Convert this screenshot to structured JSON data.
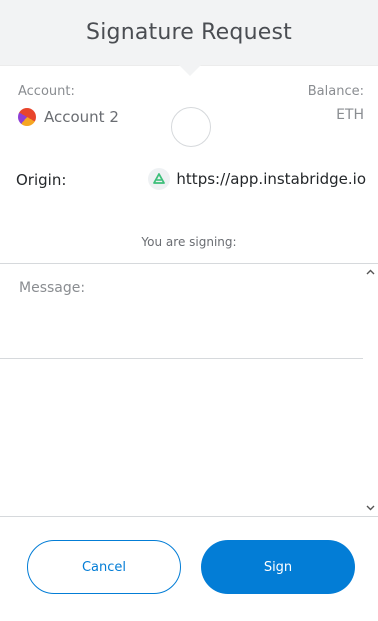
{
  "header": {
    "title": "Signature Request"
  },
  "account": {
    "label": "Account:",
    "name": "Account 2",
    "avatar_icon": "account-avatar-icon"
  },
  "balance": {
    "label": "Balance:",
    "value": "ETH"
  },
  "origin": {
    "label": "Origin:",
    "url": "https://app.instabridge.io",
    "icon": "instabridge-site-icon"
  },
  "signing": {
    "label": "You are signing:"
  },
  "message": {
    "label": "Message:"
  },
  "buttons": {
    "cancel_label": "Cancel",
    "sign_label": "Sign"
  },
  "colors": {
    "accent": "#037dd6",
    "header_bg": "#f2f3f4",
    "site_icon_green": "#3dbf7a"
  }
}
